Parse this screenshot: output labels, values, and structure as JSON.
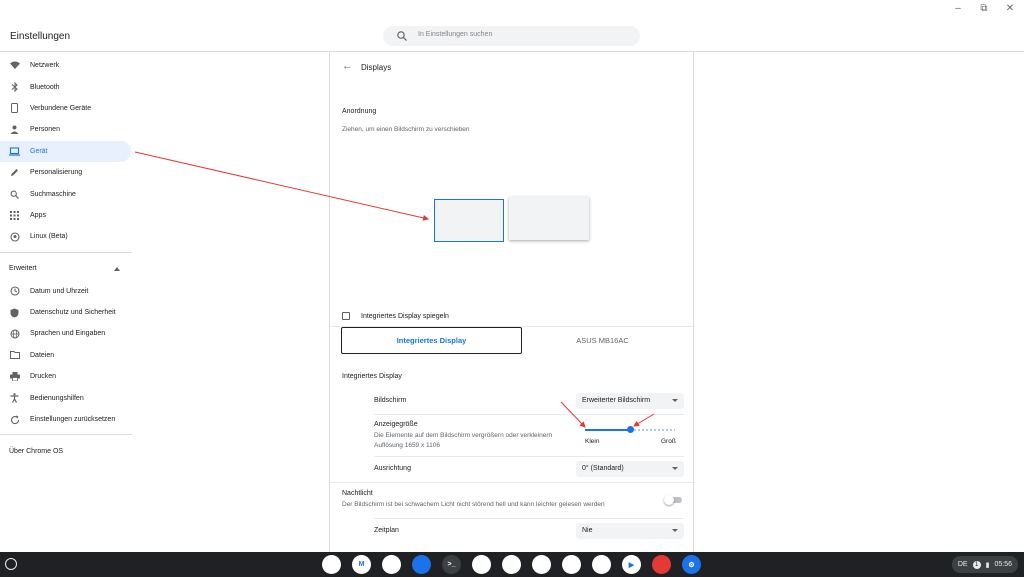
{
  "window_controls": {
    "minimize": "–",
    "restore": "⧉",
    "close": "✕"
  },
  "header": {
    "title": "Einstellungen",
    "search_placeholder": "In Einstellungen suchen"
  },
  "sidebar": {
    "items": [
      {
        "label": "Netzwerk",
        "icon": "wifi-icon"
      },
      {
        "label": "Bluetooth",
        "icon": "bluetooth-icon"
      },
      {
        "label": "Verbundene Geräte",
        "icon": "phone-icon"
      },
      {
        "label": "Personen",
        "icon": "person-icon"
      },
      {
        "label": "Gerät",
        "icon": "laptop-icon",
        "active": true
      },
      {
        "label": "Personalisierung",
        "icon": "pen-icon"
      },
      {
        "label": "Suchmaschine",
        "icon": "search-icon"
      },
      {
        "label": "Apps",
        "icon": "apps-grid-icon"
      },
      {
        "label": "Linux (Beta)",
        "icon": "linux-icon"
      }
    ],
    "advanced_label": "Erweitert",
    "advanced_items": [
      {
        "label": "Datum und Uhrzeit",
        "icon": "clock-icon"
      },
      {
        "label": "Datenschutz und Sicherheit",
        "icon": "shield-icon"
      },
      {
        "label": "Sprachen und Eingaben",
        "icon": "globe-icon"
      },
      {
        "label": "Dateien",
        "icon": "folder-icon"
      },
      {
        "label": "Drucken",
        "icon": "printer-icon"
      },
      {
        "label": "Bedienungshilfen",
        "icon": "accessibility-icon"
      },
      {
        "label": "Einstellungen zurücksetzen",
        "icon": "reset-icon"
      }
    ],
    "about_label": "Über Chrome OS"
  },
  "main": {
    "page_title": "Displays",
    "arrangement_title": "Anordnung",
    "arrangement_hint": "Ziehen, um einen Bildschirm zu verschieben",
    "mirror_label": "Integriertes Display spiegeln",
    "mirror_checked": false,
    "tabs": [
      {
        "label": "Integriertes Display",
        "selected": true
      },
      {
        "label": "ASUS MB16AC",
        "selected": false
      }
    ],
    "display_section_title": "Integriertes Display",
    "screen_label": "Bildschirm",
    "screen_value": "Erweiterter Bildschirm",
    "display_size_label": "Anzeigegröße",
    "display_size_desc": "Die Elemente auf dem Bildschirm vergrößern oder verkleinern",
    "resolution_text": "Auflösung 1659 x 1106",
    "slider_min_label": "Klein",
    "slider_max_label": "Groß",
    "slider_value": 0.5,
    "orientation_label": "Ausrichtung",
    "orientation_value": "0° (Standard)",
    "nightlight_label": "Nachtlicht",
    "nightlight_desc": "Der Bildschirm ist bei schwachem Licht nicht störend hell und kann leichter gelesen werden",
    "nightlight_on": false,
    "schedule_label": "Zeitplan",
    "schedule_value": "Nie"
  },
  "shelf": {
    "apps": [
      {
        "name": "chrome-app-icon",
        "color": "#ffffff",
        "text": ""
      },
      {
        "name": "gmail-app-icon",
        "color": "#ffffff",
        "text": "M"
      },
      {
        "name": "calendar-app-icon",
        "color": "#ffffff",
        "text": ""
      },
      {
        "name": "files-app-icon",
        "color": "#1a73e8",
        "text": ""
      },
      {
        "name": "terminal-app-icon",
        "color": "#3c4043",
        "text": ">_"
      },
      {
        "name": "docs-app-icon",
        "color": "#ffffff",
        "text": ""
      },
      {
        "name": "sheets-app-icon",
        "color": "#ffffff",
        "text": ""
      },
      {
        "name": "keep-app-icon",
        "color": "#ffffff",
        "text": ""
      },
      {
        "name": "evernote-app-icon",
        "color": "#ffffff",
        "text": ""
      },
      {
        "name": "keep-notes-app-icon",
        "color": "#ffffff",
        "text": ""
      },
      {
        "name": "play-store-app-icon",
        "color": "#ffffff",
        "text": "▶"
      },
      {
        "name": "stadia-app-icon",
        "color": "#e53935",
        "text": ""
      },
      {
        "name": "settings-app-icon",
        "color": "#1a73e8",
        "text": "⚙"
      }
    ],
    "tray": {
      "language": "DE",
      "notifications": "1",
      "time": "05:56"
    }
  }
}
